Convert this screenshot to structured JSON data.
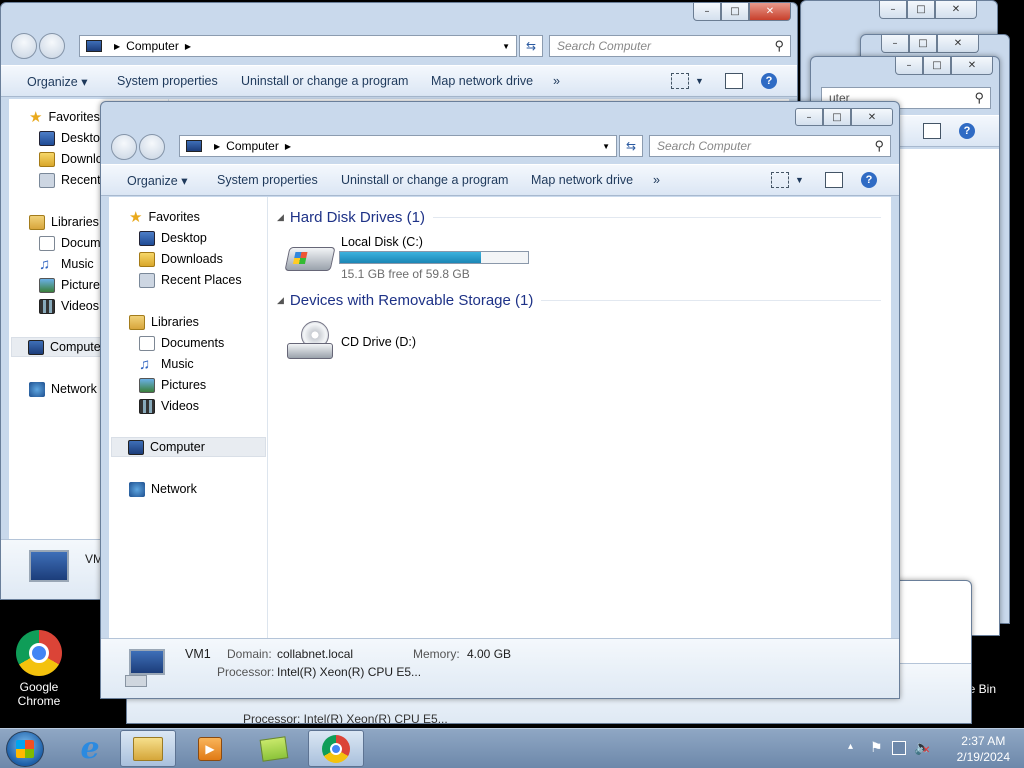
{
  "window": {
    "address": "Computer",
    "search_placeholder": "Search Computer",
    "caption_min": "–",
    "caption_max": "□",
    "caption_close": "✕"
  },
  "toolbar": {
    "organize": "Organize ▾",
    "system_properties": "System properties",
    "uninstall": "Uninstall or change a program",
    "map_drive": "Map network drive",
    "more": "»"
  },
  "nav": {
    "favorites": "Favorites",
    "desktop": "Desktop",
    "downloads": "Downloads",
    "recent_places": "Recent Places",
    "libraries": "Libraries",
    "documents": "Documents",
    "music": "Music",
    "pictures": "Pictures",
    "videos": "Videos",
    "computer": "Computer",
    "network": "Network"
  },
  "back_nav": {
    "downloads": "Downlo",
    "recent": "Recent P",
    "documents": "Docume",
    "computer": "Compute"
  },
  "groups": {
    "hdd": "Hard Disk Drives (1)",
    "removable": "Devices with Removable Storage (1)"
  },
  "drives": {
    "c_name": "Local Disk (C:)",
    "c_free": "15.1 GB free of 59.8 GB",
    "c_used_fraction": 0.75,
    "d_name": "CD Drive (D:)"
  },
  "details": {
    "name": "VM1",
    "domain_label": "Domain:",
    "domain": "collabnet.local",
    "memory_label": "Memory:",
    "memory": "4.00 GB",
    "processor_label": "Processor:",
    "processor": "Intel(R) Xeon(R) CPU E5...",
    "back_name": "VM"
  },
  "ghost": {
    "search_fragment": "uter",
    "processor_partial": "Processor:  Intel(R) Xeon(R) CPU E5..."
  },
  "desktop": {
    "chrome": "Google Chrome",
    "recycle": "cle Bin"
  },
  "tray": {
    "time": "2:37 AM",
    "date": "2/19/2024",
    "show_hidden": "▴"
  }
}
